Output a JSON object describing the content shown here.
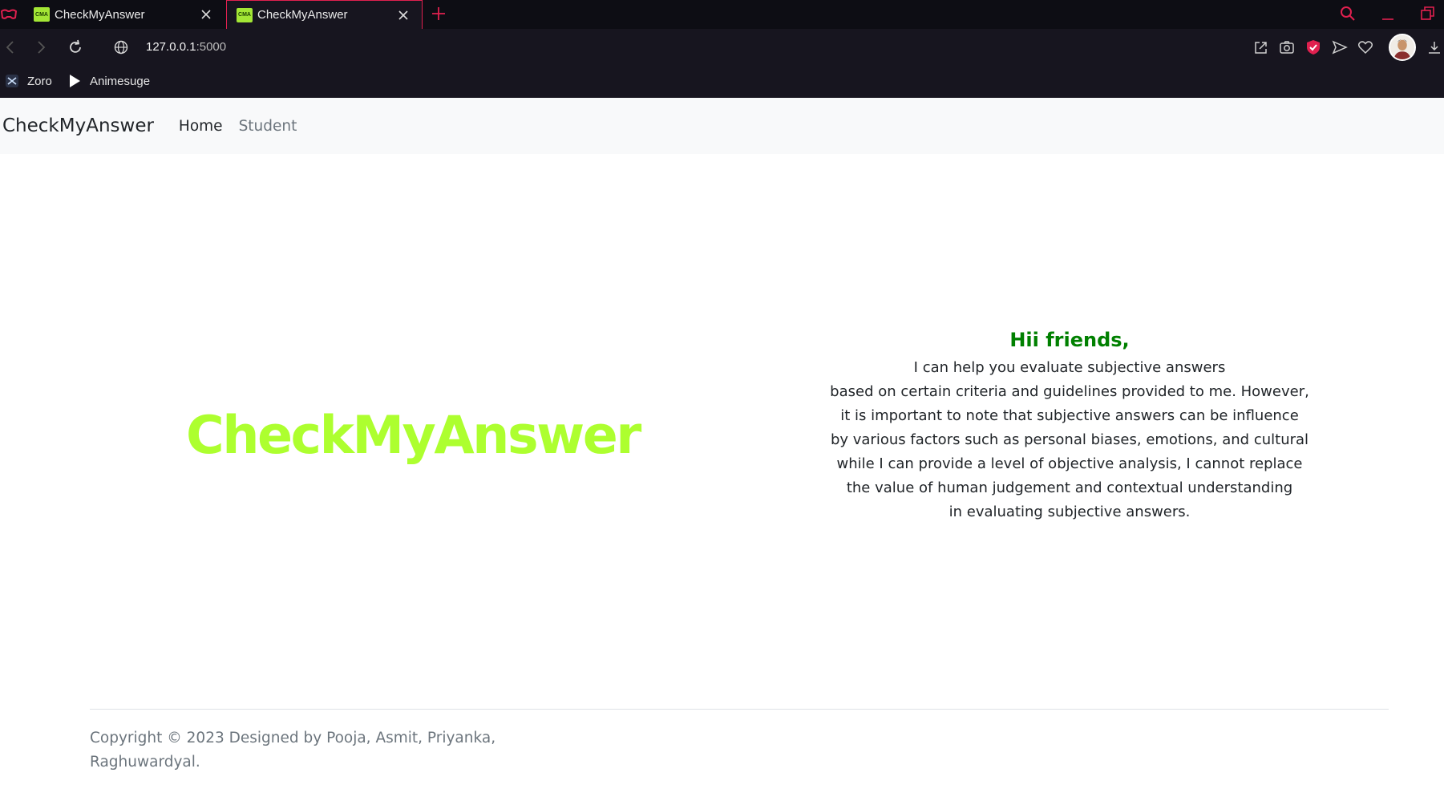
{
  "browser": {
    "tabs": [
      {
        "favicon_text": "CMA",
        "label": "CheckMyAnswer",
        "active": false
      },
      {
        "favicon_text": "CMA",
        "label": "CheckMyAnswer",
        "active": true
      }
    ],
    "address": {
      "host": "127.0.0.1",
      "port": ":5000"
    },
    "bookmarks": [
      {
        "label": "Zoro",
        "icon": "zoro-icon"
      },
      {
        "label": "Animesuge",
        "icon": "play-icon"
      }
    ],
    "accent_color": "#e0204f"
  },
  "navbar": {
    "brand": "CheckMyAnswer",
    "links": [
      "Home",
      "Student"
    ]
  },
  "hero": {
    "title": "CheckMyAnswer",
    "title_color": "#adff2f"
  },
  "intro": {
    "greeting": "Hii friends,",
    "greeting_color": "#008000",
    "lines": [
      "I can help you evaluate subjective answers",
      "based on certain criteria and guidelines provided to me. However,",
      "it is important to note that subjective answers can be influence",
      "by various factors such as personal biases, emotions, and cultural",
      "while I can provide a level of objective analysis, I cannot replace",
      "the value of human judgement and contextual understanding",
      "in evaluating subjective answers."
    ]
  },
  "footer": {
    "line1": "Copyright © 2023 Designed by Pooja, Asmit, Priyanka,",
    "line2": "Raghuwardyal."
  }
}
